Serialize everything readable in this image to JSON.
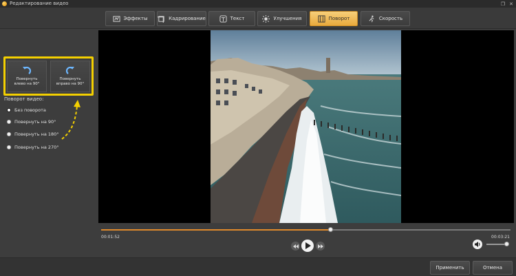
{
  "window": {
    "title": "Редактирование видео"
  },
  "tabs": [
    {
      "label": "Эффекты",
      "icon": "effects-icon"
    },
    {
      "label": "Кадрирование",
      "icon": "crop-icon"
    },
    {
      "label": "Текст",
      "icon": "text-icon"
    },
    {
      "label": "Улучшения",
      "icon": "enhance-icon"
    },
    {
      "label": "Поворот",
      "icon": "rotate-tab-icon",
      "active": true
    },
    {
      "label": "Скорость",
      "icon": "speed-icon"
    }
  ],
  "rotation_buttons": {
    "left": "Повернуть\nвлево на 90°",
    "right": "Повернуть\nвправо на 90°"
  },
  "rotation_section": {
    "label": "Поворот видео:",
    "options": [
      {
        "label": "Без поворота",
        "checked": true
      },
      {
        "label": "Повернуть на 90°",
        "checked": false
      },
      {
        "label": "Повернуть на 180°",
        "checked": false
      },
      {
        "label": "Повернуть на 270°",
        "checked": false
      }
    ]
  },
  "player": {
    "current_time": "00:01:52",
    "total_time": "00:03:21",
    "progress": 0.56,
    "volume": 0.9
  },
  "footer": {
    "apply_label": "Применить",
    "cancel_label": "Отмена"
  },
  "colors": {
    "accent": "#E9A93C",
    "highlight": "#F4D000",
    "progress": "#E08A2C"
  }
}
